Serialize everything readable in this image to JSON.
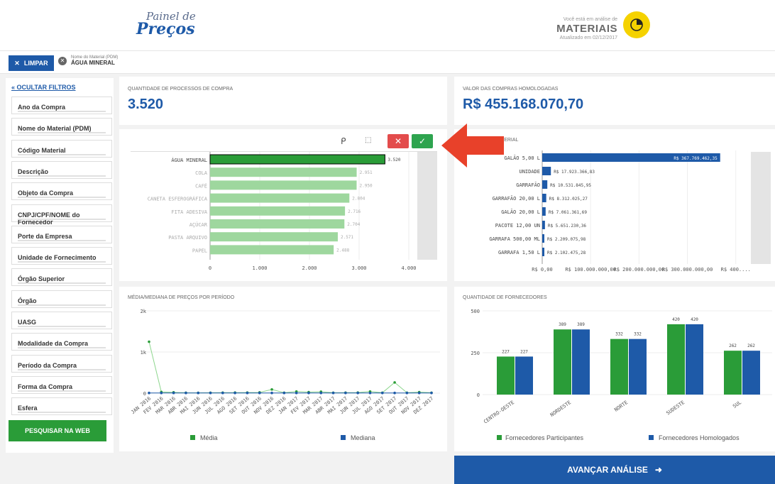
{
  "header": {
    "logo_line1": "Painel de",
    "logo_line2": "Preços",
    "analysis_small": "Você está em análise de",
    "analysis_main": "MATERIAIS",
    "updated": "Atualizado em 02/12/2017"
  },
  "filterbar": {
    "clear_label": "LIMPAR",
    "chip_label": "Nome do Material (PDM)",
    "chip_value": "ÁGUA MINERAL"
  },
  "sidebar": {
    "hide_label": "OCULTAR FILTROS",
    "items": [
      "Ano da Compra",
      "Nome do Material (PDM)",
      "Código Material",
      "Descrição",
      "Objeto da Compra",
      "CNPJ/CPF/NOME do Fornecedor",
      "Porte da Empresa",
      "Unidade de Fornecimento",
      "Órgão Superior",
      "Órgão",
      "UASG",
      "Modalidade da Compra",
      "Período da Compra",
      "Forma da Compra",
      "Esfera"
    ],
    "web_search": "PESQUISAR NA WEB"
  },
  "kpi": {
    "processes_label": "QUANTIDADE DE PROCESSOS DE COMPRA",
    "processes_value": "3.520",
    "value_label": "VALOR DAS COMPRAS HOMOLOGADAS",
    "value_value": "R$ 455.168.070,70"
  },
  "cards": {
    "material_title": "MPRAS POR MATERIAL",
    "period_title": "MÉDIA/MEDIANA DE PREÇOS POR PERÍODO",
    "suppliers_title": "QUANTIDADE DE FORNECEDORES"
  },
  "toolbar": {
    "lasso_icon": "lasso-icon",
    "clear_icon": "clear-selection-icon",
    "cancel_icon": "cancel-icon",
    "confirm_icon": "check-icon"
  },
  "advance": {
    "label": "AVANÇAR ANÁLISE",
    "icon": "arrow-right-icon"
  },
  "colors": {
    "brand": "#1e5aa8",
    "green": "#2a9c38",
    "yellow": "#f5d200",
    "arrow": "#e8412a"
  },
  "chart_data": [
    {
      "type": "bar",
      "orientation": "horizontal",
      "categories": [
        "ÁGUA MINERAL",
        "COLA",
        "CAFÉ",
        "CANETA ESFEROGRÁFICA",
        "FITA ADESIVA",
        "AÇÚCAR",
        "PASTA ARQUIVO",
        "PAPEL"
      ],
      "values": [
        3520,
        2951,
        2950,
        2804,
        2716,
        2704,
        2571,
        2488
      ],
      "labels": [
        "3.520",
        "2.951",
        "2.950",
        "2.804",
        "2.716",
        "2.704",
        "2.571",
        "2.488"
      ],
      "xticks": [
        "0",
        "1.000",
        "2.000",
        "3.000",
        "4.000"
      ],
      "xlim": [
        0,
        4000
      ]
    },
    {
      "type": "bar",
      "orientation": "horizontal",
      "categories": [
        "GALÃO 5,00 L",
        "UNIDADE",
        "GARRAFÃO",
        "GARRAFÃO 20,00 L",
        "GALÃO 20,00 L",
        "PACOTE 12,00 UN",
        "GARRAFA 500,00 ML",
        "GARRAFA 1,50 L"
      ],
      "values": [
        367769462.35,
        17923366.83,
        10531845.95,
        8312025.27,
        7061361.69,
        5651230.36,
        2209075.98,
        2102475.28
      ],
      "labels": [
        "R$ 367.769.462,35",
        "R$ 17.923.366,83",
        "R$ 10.531.845,95",
        "R$ 8.312.025,27",
        "R$ 7.061.361,69",
        "R$ 5.651.230,36",
        "R$ 2.209.075,98",
        "R$ 2.102.475,28"
      ],
      "xticks": [
        "R$ 0,00",
        "R$ 100.000.000,00",
        "R$ 200.000.000,00",
        "R$ 300.000.000,00",
        "R$ 400...."
      ],
      "xlim": [
        0,
        440000000
      ]
    },
    {
      "type": "line",
      "x": [
        "JAN 2016",
        "FEV 2016",
        "MAR 2016",
        "ABR 2016",
        "MAI 2016",
        "JUN 2016",
        "JUL 2016",
        "AGO 2016",
        "SET 2016",
        "OUT 2016",
        "NOV 2016",
        "DEZ 2016",
        "JAN 2017",
        "FEV 2017",
        "MAR 2017",
        "ABR 2017",
        "MAI 2017",
        "JUN 2017",
        "JUL 2017",
        "AGO 2017",
        "SET 2017",
        "OUT 2017",
        "NOV 2017",
        "DEZ 2017"
      ],
      "series": [
        {
          "name": "Média",
          "values": [
            1250,
            30,
            20,
            10,
            8,
            10,
            12,
            14,
            15,
            18,
            90,
            10,
            40,
            25,
            35,
            10,
            12,
            15,
            40,
            10,
            260,
            10,
            25,
            10
          ]
        },
        {
          "name": "Mediana",
          "values": [
            5,
            5,
            5,
            5,
            5,
            5,
            5,
            5,
            5,
            5,
            5,
            5,
            5,
            5,
            5,
            5,
            5,
            5,
            5,
            5,
            5,
            5,
            5,
            5
          ]
        }
      ],
      "yticks": [
        "0",
        "1k",
        "2k"
      ],
      "ylim": [
        0,
        2000
      ]
    },
    {
      "type": "bar",
      "categories": [
        "CENTRO-OESTE",
        "NORDESTE",
        "NORTE",
        "SUDESTE",
        "SUL"
      ],
      "series": [
        {
          "name": "Fornecedores Participantes",
          "values": [
            227,
            389,
            332,
            420,
            262
          ]
        },
        {
          "name": "Fornecedores Homologados",
          "values": [
            227,
            389,
            332,
            420,
            262
          ]
        }
      ],
      "yticks": [
        "0",
        "250",
        "500"
      ],
      "ylim": [
        0,
        500
      ]
    }
  ]
}
